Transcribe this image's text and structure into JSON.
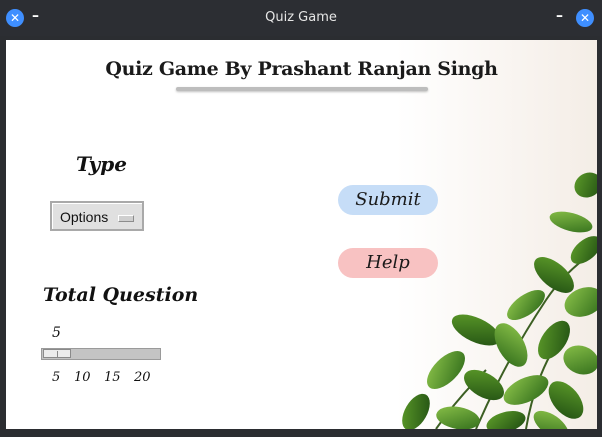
{
  "window": {
    "title": "Quiz Game",
    "close_label": "✕",
    "minimize_label": "–"
  },
  "app": {
    "heading": "Quiz Game By Prashant Ranjan Singh"
  },
  "type_section": {
    "label": "Type",
    "dropdown_value": "Options"
  },
  "questions_section": {
    "label": "Total Question",
    "current_value": "5",
    "tick_labels": [
      "5",
      "10",
      "15",
      "20"
    ]
  },
  "buttons": {
    "submit_label": "Submit",
    "help_label": "Help"
  },
  "colors": {
    "submit_bg": "#c6ddf7",
    "help_bg": "#f8c2c2",
    "titlebar_bg": "#2c2e33",
    "window_button": "#3f8fff"
  },
  "icons": {
    "close": "close-icon",
    "minimize": "minimize-icon",
    "dropdown_indicator": "dropdown-indicator-icon"
  }
}
